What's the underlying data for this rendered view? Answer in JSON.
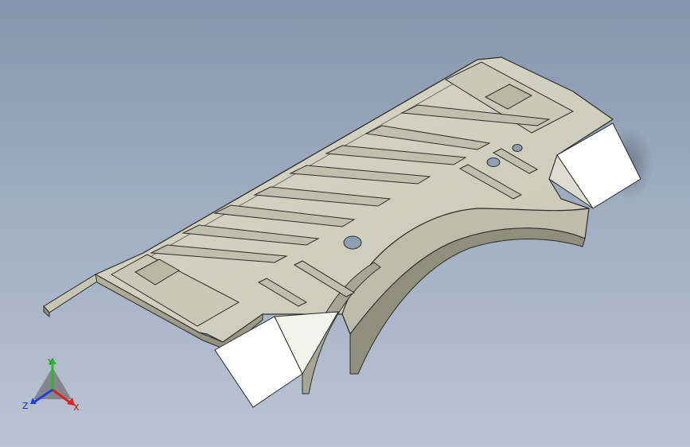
{
  "viewport": {
    "background_top": "#8595ab",
    "background_bottom": "#bac4d3",
    "part_color": "#cfcfbf",
    "part_shade": "#a9a996",
    "edge_color": "#2e2e2a"
  },
  "triad": {
    "x_label": "X",
    "y_label": "Y",
    "z_label": "Z",
    "x_color": "#e02020",
    "y_color": "#1fc01f",
    "z_color": "#2040e0"
  }
}
